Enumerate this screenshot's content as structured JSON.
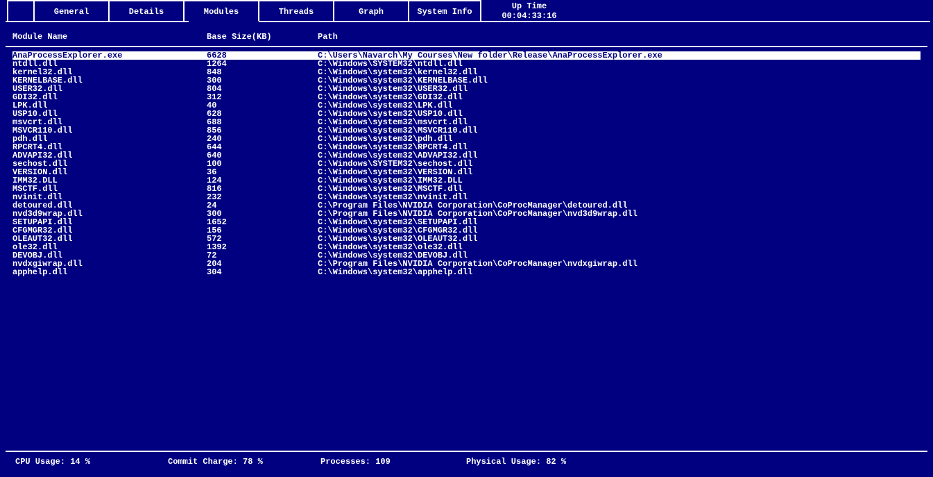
{
  "tabs": {
    "general": "General",
    "details": "Details",
    "modules": "Modules",
    "threads": "Threads",
    "graph": "Graph",
    "sysinfo": "System Info",
    "uptime_label": "Up Time",
    "uptime_value": "00:04:33:16",
    "active": "modules"
  },
  "columns": {
    "name": "Module Name",
    "size": "Base Size(KB)",
    "path": "Path"
  },
  "rows": [
    {
      "name": "AnaProcessExplorer.exe",
      "size": "6628",
      "path": "C:\\Users\\Navarch\\My Courses\\New folder\\Release\\AnaProcessExplorer.exe",
      "selected": true
    },
    {
      "name": "ntdll.dll",
      "size": "1264",
      "path": "C:\\Windows\\SYSTEM32\\ntdll.dll"
    },
    {
      "name": "kernel32.dll",
      "size": "848",
      "path": "C:\\Windows\\system32\\kernel32.dll"
    },
    {
      "name": "KERNELBASE.dll",
      "size": "300",
      "path": "C:\\Windows\\system32\\KERNELBASE.dll"
    },
    {
      "name": "USER32.dll",
      "size": "804",
      "path": "C:\\Windows\\system32\\USER32.dll"
    },
    {
      "name": "GDI32.dll",
      "size": "312",
      "path": "C:\\Windows\\system32\\GDI32.dll"
    },
    {
      "name": "LPK.dll",
      "size": "40",
      "path": "C:\\Windows\\system32\\LPK.dll"
    },
    {
      "name": "USP10.dll",
      "size": "628",
      "path": "C:\\Windows\\system32\\USP10.dll"
    },
    {
      "name": "msvcrt.dll",
      "size": "688",
      "path": "C:\\Windows\\system32\\msvcrt.dll"
    },
    {
      "name": "MSVCR110.dll",
      "size": "856",
      "path": "C:\\Windows\\system32\\MSVCR110.dll"
    },
    {
      "name": "pdh.dll",
      "size": "240",
      "path": "C:\\Windows\\system32\\pdh.dll"
    },
    {
      "name": "RPCRT4.dll",
      "size": "644",
      "path": "C:\\Windows\\system32\\RPCRT4.dll"
    },
    {
      "name": "ADVAPI32.dll",
      "size": "640",
      "path": "C:\\Windows\\system32\\ADVAPI32.dll"
    },
    {
      "name": "sechost.dll",
      "size": "100",
      "path": "C:\\Windows\\SYSTEM32\\sechost.dll"
    },
    {
      "name": "VERSION.dll",
      "size": "36",
      "path": "C:\\Windows\\system32\\VERSION.dll"
    },
    {
      "name": "IMM32.DLL",
      "size": "124",
      "path": "C:\\Windows\\system32\\IMM32.DLL"
    },
    {
      "name": "MSCTF.dll",
      "size": "816",
      "path": "C:\\Windows\\system32\\MSCTF.dll"
    },
    {
      "name": "nvinit.dll",
      "size": "232",
      "path": "C:\\Windows\\system32\\nvinit.dll"
    },
    {
      "name": "detoured.dll",
      "size": "24",
      "path": "C:\\Program Files\\NVIDIA Corporation\\CoProcManager\\detoured.dll"
    },
    {
      "name": "nvd3d9wrap.dll",
      "size": "300",
      "path": "C:\\Program Files\\NVIDIA Corporation\\CoProcManager\\nvd3d9wrap.dll"
    },
    {
      "name": "SETUPAPI.dll",
      "size": "1652",
      "path": "C:\\Windows\\system32\\SETUPAPI.dll"
    },
    {
      "name": "CFGMGR32.dll",
      "size": "156",
      "path": "C:\\Windows\\system32\\CFGMGR32.dll"
    },
    {
      "name": "OLEAUT32.dll",
      "size": "572",
      "path": "C:\\Windows\\system32\\OLEAUT32.dll"
    },
    {
      "name": "ole32.dll",
      "size": "1392",
      "path": "C:\\Windows\\system32\\ole32.dll"
    },
    {
      "name": "DEVOBJ.dll",
      "size": "72",
      "path": "C:\\Windows\\system32\\DEVOBJ.dll"
    },
    {
      "name": "nvdxgiwrap.dll",
      "size": "204",
      "path": "C:\\Program Files\\NVIDIA Corporation\\CoProcManager\\nvdxgiwrap.dll"
    },
    {
      "name": "apphelp.dll",
      "size": "304",
      "path": "C:\\Windows\\system32\\apphelp.dll"
    }
  ],
  "status": {
    "cpu": "CPU Usage: 14 %",
    "commit": "Commit Charge: 78 %",
    "processes": "Processes: 109",
    "physical": "Physical Usage: 82 %"
  }
}
